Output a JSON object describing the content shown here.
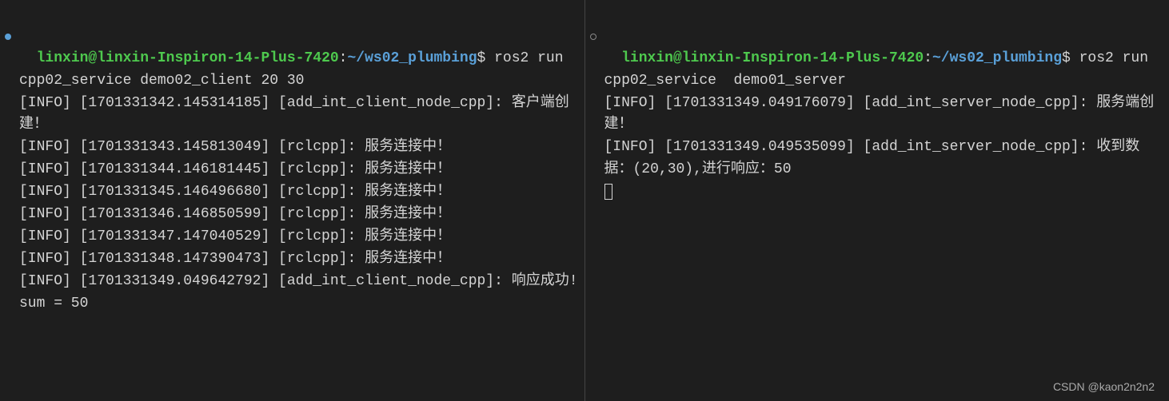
{
  "left": {
    "user_host": "linxin@linxin-Inspiron-14-Plus-7420",
    "colon": ":",
    "path": "~/ws02_plumbing",
    "prompt": "$ ",
    "command": "ros2 run cpp02_service demo02_client 20 30",
    "lines": [
      "[INFO] [1701331342.145314185] [add_int_client_node_cpp]: 客户端创建！",
      "[INFO] [1701331343.145813049] [rclcpp]: 服务连接中！",
      "[INFO] [1701331344.146181445] [rclcpp]: 服务连接中！",
      "[INFO] [1701331345.146496680] [rclcpp]: 服务连接中！",
      "[INFO] [1701331346.146850599] [rclcpp]: 服务连接中！",
      "[INFO] [1701331347.147040529] [rclcpp]: 服务连接中！",
      "[INFO] [1701331348.147390473] [rclcpp]: 服务连接中！",
      "[INFO] [1701331349.049642792] [add_int_client_node_cpp]: 响应成功!sum = 50"
    ]
  },
  "right": {
    "user_host": "linxin@linxin-Inspiron-14-Plus-7420",
    "colon": ":",
    "path": "~/ws02_plumbing",
    "prompt": "$ ",
    "command": "ros2 run cpp02_service  demo01_server",
    "lines": [
      "[INFO] [1701331349.049176079] [add_int_server_node_cpp]: 服务端创建！",
      "[INFO] [1701331349.049535099] [add_int_server_node_cpp]: 收到数据：(20,30),进行响应：50"
    ]
  },
  "watermark": "CSDN @kaon2n2n2"
}
